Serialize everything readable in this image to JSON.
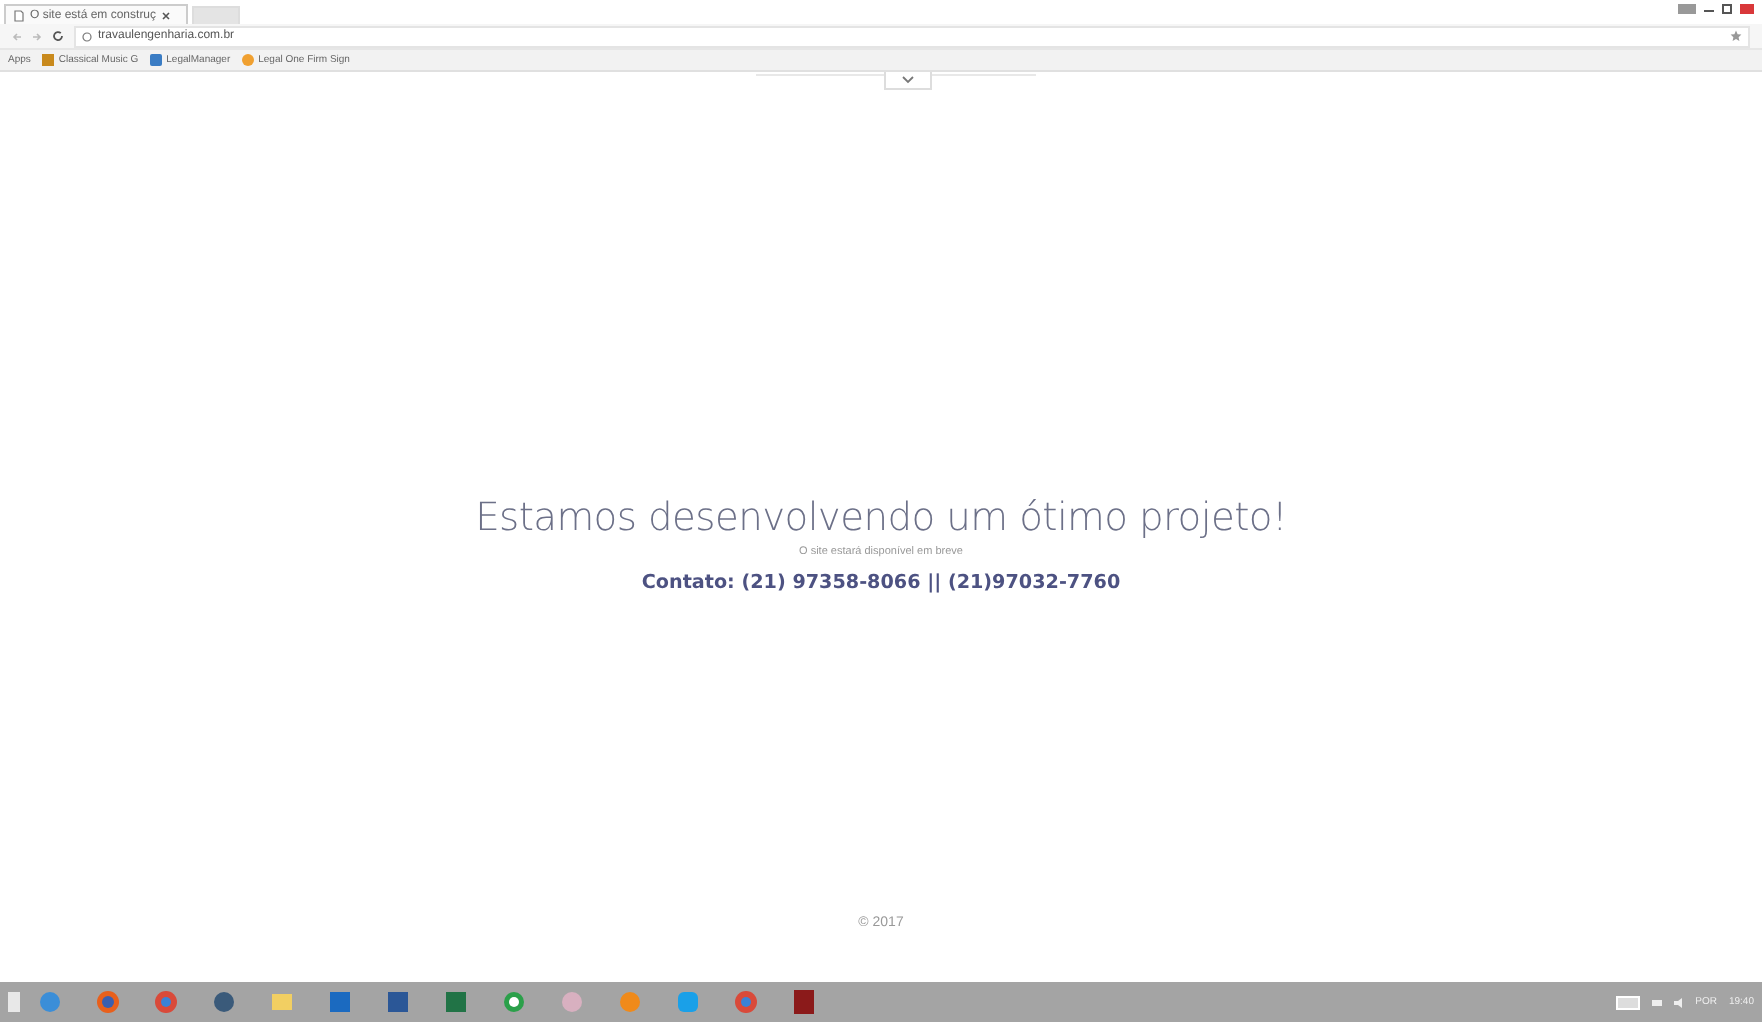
{
  "browser": {
    "tab": {
      "title": "O site está em construç",
      "selected": true
    },
    "address": "travaulengenharia.com.br",
    "bookmarks": [
      {
        "label": "Apps"
      },
      {
        "label": "Classical Music G"
      },
      {
        "label": "LegalManager"
      },
      {
        "label": "Legal One Firm Sign"
      }
    ]
  },
  "page": {
    "heading": "Estamos desenvolvendo um ótimo projeto!",
    "subtitle": "O site estará disponível em breve",
    "contact": "Contato: (21) 97358-8066 || (21)97032-7760",
    "footer": "© 2017"
  },
  "taskbar": {
    "language": "POR",
    "clock": "19:40"
  }
}
